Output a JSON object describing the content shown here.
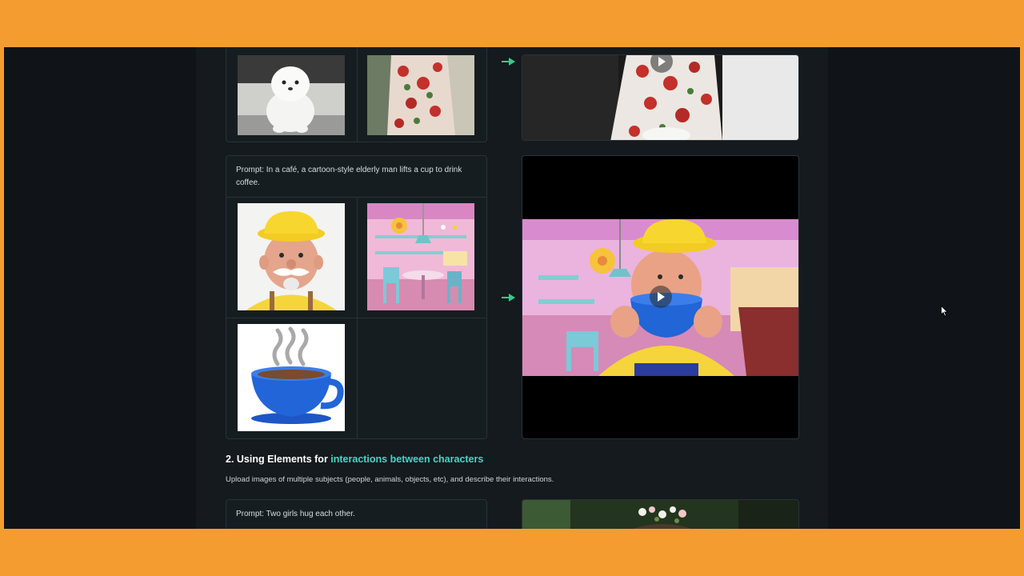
{
  "sections": {
    "example_1": {
      "prompt": "Prompt: In a café, a cartoon-style elderly man lifts a cup to drink coffee.",
      "inputs": [
        "elderly-man-character",
        "cafe-interior",
        "blue-coffee-cup"
      ]
    },
    "section_2": {
      "title_prefix": "2. Using Elements for ",
      "title_highlight": "interactions between characters",
      "description": "Upload images of multiple subjects (people, animals, objects, etc), and describe their interactions.",
      "prompt": "Prompt: Two girls hug each other."
    }
  },
  "colors": {
    "accent": "#3fd7c6",
    "arrow": "#2ecf8a",
    "frame": "#f49c2f"
  }
}
